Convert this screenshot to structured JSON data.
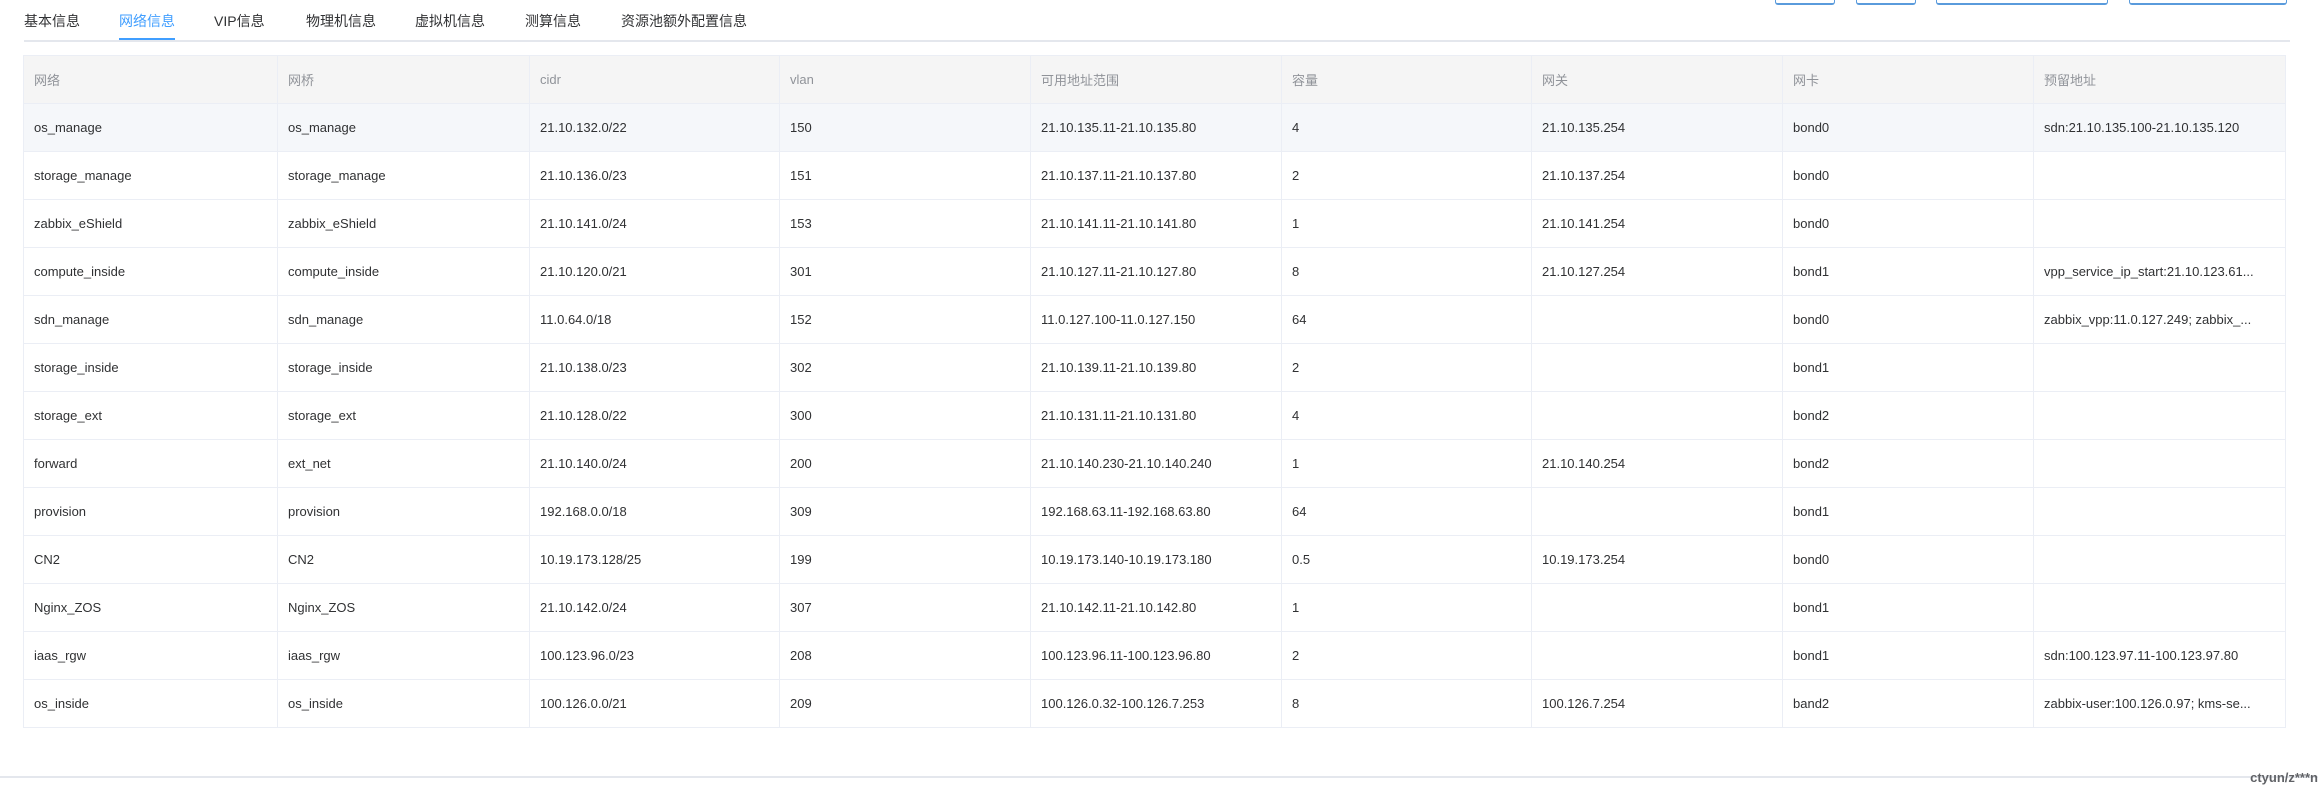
{
  "tabs": [
    {
      "label": "基本信息"
    },
    {
      "label": "网络信息"
    },
    {
      "label": "VIP信息"
    },
    {
      "label": "物理机信息"
    },
    {
      "label": "虚拟机信息"
    },
    {
      "label": "测算信息"
    },
    {
      "label": "资源池额外配置信息"
    }
  ],
  "active_tab": "网络信息",
  "table": {
    "headers": [
      "网络",
      "网桥",
      "cidr",
      "vlan",
      "可用地址范围",
      "容量",
      "网关",
      "网卡",
      "预留地址"
    ],
    "rows": [
      [
        "os_manage",
        "os_manage",
        "21.10.132.0/22",
        "150",
        "21.10.135.11-21.10.135.80",
        "4",
        "21.10.135.254",
        "bond0",
        "sdn:21.10.135.100-21.10.135.120"
      ],
      [
        "storage_manage",
        "storage_manage",
        "21.10.136.0/23",
        "151",
        "21.10.137.11-21.10.137.80",
        "2",
        "21.10.137.254",
        "bond0",
        ""
      ],
      [
        "zabbix_eShield",
        "zabbix_eShield",
        "21.10.141.0/24",
        "153",
        "21.10.141.11-21.10.141.80",
        "1",
        "21.10.141.254",
        "bond0",
        ""
      ],
      [
        "compute_inside",
        "compute_inside",
        "21.10.120.0/21",
        "301",
        "21.10.127.11-21.10.127.80",
        "8",
        "21.10.127.254",
        "bond1",
        "vpp_service_ip_start:21.10.123.61..."
      ],
      [
        "sdn_manage",
        "sdn_manage",
        "11.0.64.0/18",
        "152",
        "11.0.127.100-11.0.127.150",
        "64",
        "",
        "bond0",
        "zabbix_vpp:11.0.127.249; zabbix_..."
      ],
      [
        "storage_inside",
        "storage_inside",
        "21.10.138.0/23",
        "302",
        "21.10.139.11-21.10.139.80",
        "2",
        "",
        "bond1",
        ""
      ],
      [
        "storage_ext",
        "storage_ext",
        "21.10.128.0/22",
        "300",
        "21.10.131.11-21.10.131.80",
        "4",
        "",
        "bond2",
        ""
      ],
      [
        "forward",
        "ext_net",
        "21.10.140.0/24",
        "200",
        "21.10.140.230-21.10.140.240",
        "1",
        "21.10.140.254",
        "bond2",
        ""
      ],
      [
        "provision",
        "provision",
        "192.168.0.0/18",
        "309",
        "192.168.63.11-192.168.63.80",
        "64",
        "",
        "bond1",
        ""
      ],
      [
        "CN2",
        "CN2",
        "10.19.173.128/25",
        "199",
        "10.19.173.140-10.19.173.180",
        "0.5",
        "10.19.173.254",
        "bond0",
        ""
      ],
      [
        "Nginx_ZOS",
        "Nginx_ZOS",
        "21.10.142.0/24",
        "307",
        "21.10.142.11-21.10.142.80",
        "1",
        "",
        "bond1",
        ""
      ],
      [
        "iaas_rgw",
        "iaas_rgw",
        "100.123.96.0/23",
        "208",
        "100.123.96.11-100.123.96.80",
        "2",
        "",
        "bond1",
        "sdn:100.123.97.11-100.123.97.80"
      ],
      [
        "os_inside",
        "os_inside",
        "100.126.0.0/21",
        "209",
        "100.126.0.32-100.126.7.253",
        "8",
        "100.126.7.254",
        "band2",
        "zabbix-user:100.126.0.97; kms-se..."
      ]
    ]
  },
  "footer": {
    "text": "ctyun/z***n"
  },
  "colors": {
    "accent": "#409eff",
    "header_bg": "#f5f5f5",
    "border": "#ebeef5"
  }
}
